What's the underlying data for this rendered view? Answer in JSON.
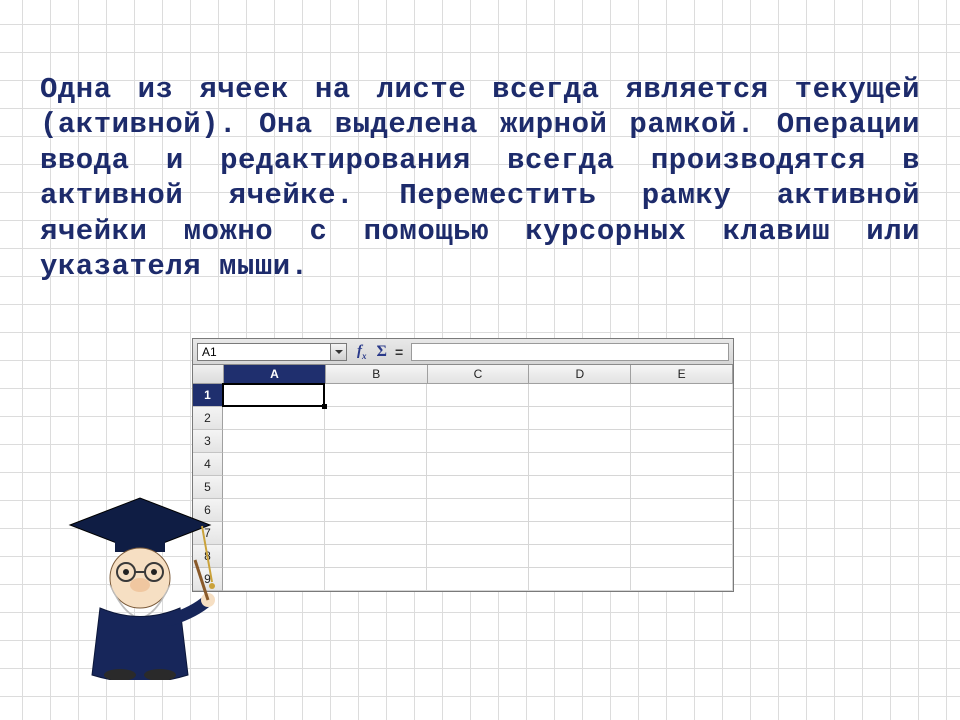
{
  "paragraph": "Одна из ячеек на листе всегда является текущей (активной). Она выделена жирной рамкой. Операции ввода и редактирования всегда производятся в активной ячейке. Переместить рамку активной ячейки можно с помощью курсорных клавиш или указателя мыши.",
  "spreadsheet": {
    "name_box": "A1",
    "fx_label": "f",
    "fx_sub": "x",
    "sigma_label": "Σ",
    "eq_label": "=",
    "columns": [
      "A",
      "B",
      "C",
      "D",
      "E"
    ],
    "rows": [
      "1",
      "2",
      "3",
      "4",
      "5",
      "6",
      "7",
      "8",
      "9"
    ],
    "active_cell": "A1"
  }
}
